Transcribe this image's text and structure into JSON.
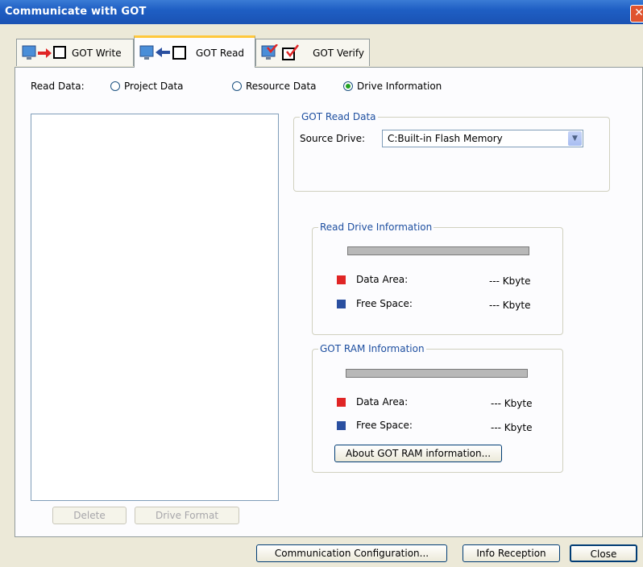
{
  "window": {
    "title": "Communicate with GOT",
    "close_glyph": "✕"
  },
  "tabs": [
    {
      "label": "GOT Write",
      "icon": "monitor-arrow-right-icon"
    },
    {
      "label": "GOT Read",
      "icon": "monitor-arrow-left-icon"
    },
    {
      "label": "GOT Verify",
      "icon": "monitor-check-icon"
    }
  ],
  "read_data": {
    "label": "Read Data:",
    "options": [
      "Project Data",
      "Resource Data",
      "Drive Information"
    ],
    "selected": "Drive Information"
  },
  "left_buttons": {
    "delete": "Delete",
    "drive_format": "Drive Format"
  },
  "got_read_data": {
    "title": "GOT Read Data",
    "source_label": "Source Drive:",
    "source_value": "C:Built-in Flash Memory"
  },
  "read_drive_info": {
    "title": "Read Drive Information",
    "data_area_label": "Data Area:",
    "data_area_value": "--- Kbyte",
    "free_space_label": "Free Space:",
    "free_space_value": "--- Kbyte"
  },
  "got_ram_info": {
    "title": "GOT RAM Information",
    "data_area_label": "Data Area:",
    "data_area_value": "--- Kbyte",
    "free_space_label": "Free Space:",
    "free_space_value": "--- Kbyte",
    "about_button": "About GOT RAM information..."
  },
  "bottom_buttons": {
    "comm_config": "Communication Configuration...",
    "info_reception": "Info Reception",
    "close": "Close"
  },
  "colors": {
    "data_area": "#e02525",
    "free_space": "#2a4fa0",
    "title_bar": "#1f5fc4"
  }
}
